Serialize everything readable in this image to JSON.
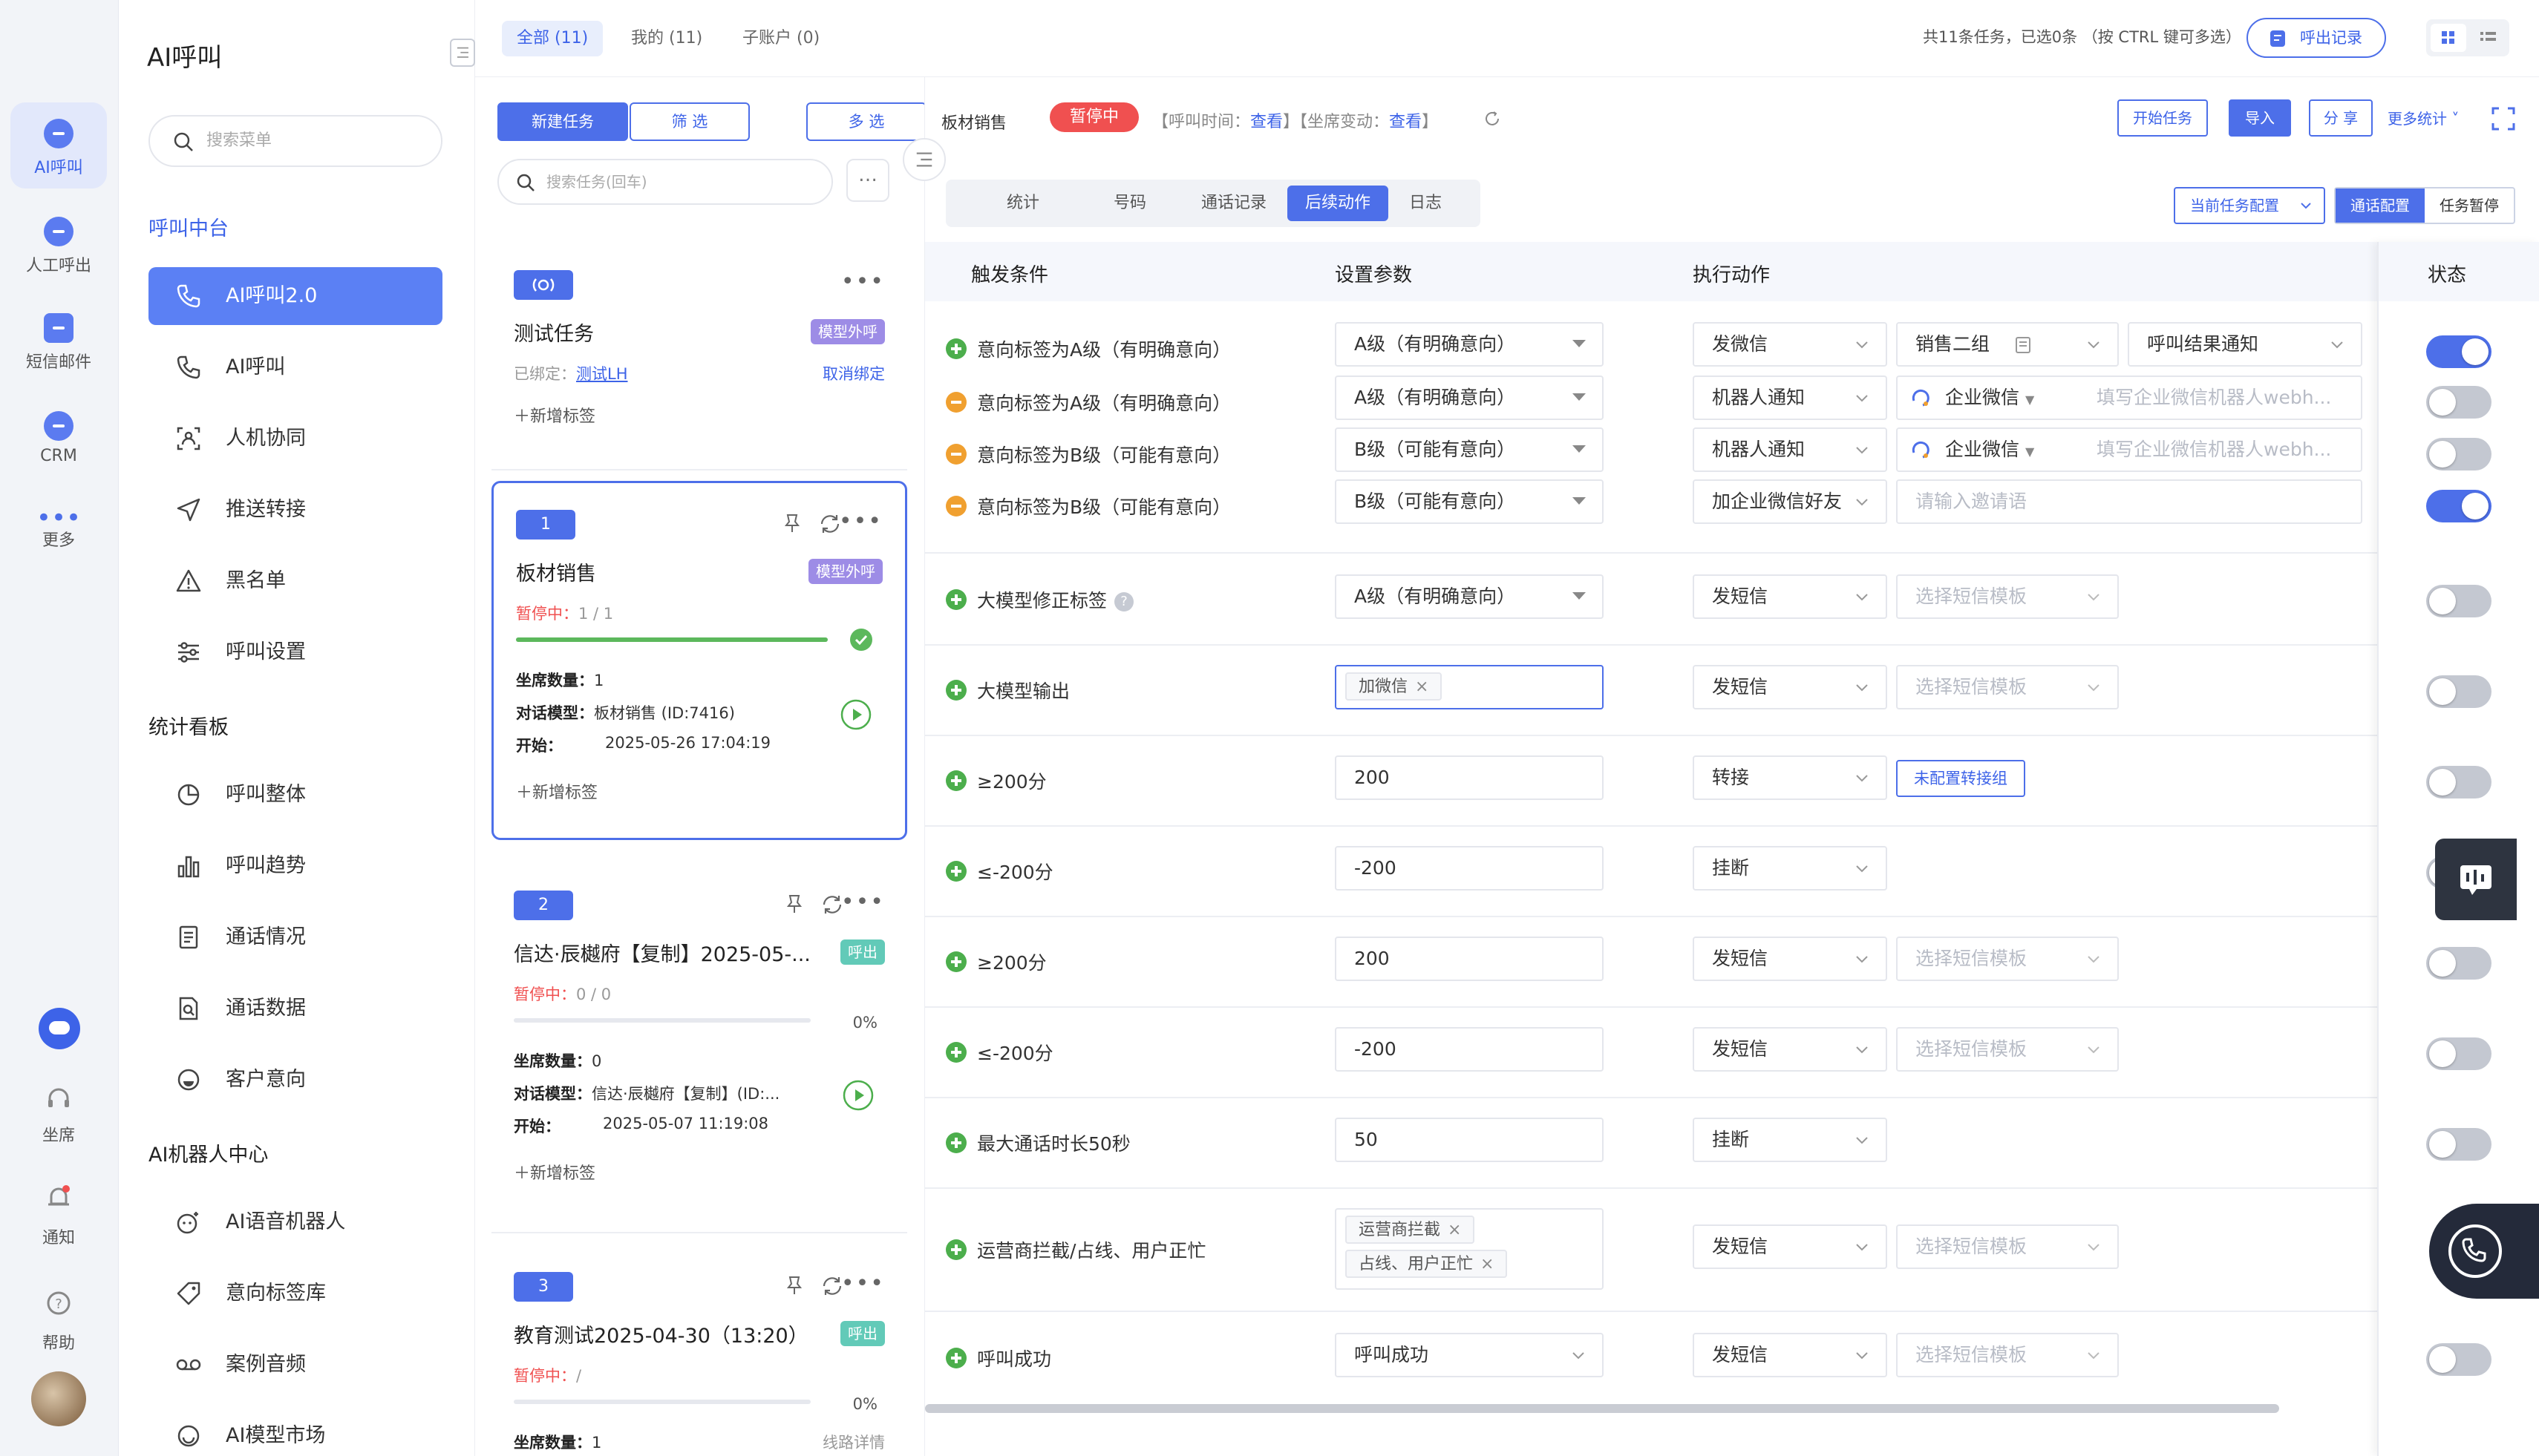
{
  "colors": {
    "primary": "#4d6fe9",
    "danger": "#f05050",
    "success": "#5cb85c",
    "warning": "#f0a030"
  },
  "rail": {
    "items": [
      {
        "label": "AI呼叫",
        "icon": "robot-icon",
        "active": true
      },
      {
        "label": "人工呼出",
        "icon": "headset-icon"
      },
      {
        "label": "短信邮件",
        "icon": "message-icon"
      },
      {
        "label": "CRM",
        "icon": "user-icon"
      },
      {
        "label": "更多",
        "icon": "more-icon"
      }
    ],
    "bottom": [
      {
        "label": "坐席",
        "icon": "headphone-icon"
      },
      {
        "label": "通知",
        "icon": "bell-icon"
      },
      {
        "label": "帮助",
        "icon": "help-icon"
      }
    ]
  },
  "menu": {
    "title": "AI呼叫",
    "search_placeholder": "搜索菜单",
    "sections": [
      {
        "label": "呼叫中台",
        "items": [
          {
            "label": "AI呼叫2.0",
            "icon": "phone-call-icon",
            "active": true
          },
          {
            "label": "AI呼叫",
            "icon": "phone-icon"
          },
          {
            "label": "人机协同",
            "icon": "collab-icon"
          },
          {
            "label": "推送转接",
            "icon": "send-icon"
          },
          {
            "label": "黑名单",
            "icon": "warning-icon"
          },
          {
            "label": "呼叫设置",
            "icon": "sliders-icon"
          }
        ]
      },
      {
        "label": "统计看板",
        "items": [
          {
            "label": "呼叫整体",
            "icon": "pie-chart-icon"
          },
          {
            "label": "呼叫趋势",
            "icon": "bar-chart-icon"
          },
          {
            "label": "通话情况",
            "icon": "document-icon"
          },
          {
            "label": "通话数据",
            "icon": "file-search-icon"
          },
          {
            "label": "客户意向",
            "icon": "smile-icon"
          }
        ]
      },
      {
        "label": "AI机器人中心",
        "items": [
          {
            "label": "AI语音机器人",
            "icon": "bot-icon"
          },
          {
            "label": "意向标签库",
            "icon": "tag-icon"
          },
          {
            "label": "案例音频",
            "icon": "voicemail-icon"
          },
          {
            "label": "AI模型市场",
            "icon": "market-icon"
          }
        ]
      }
    ]
  },
  "topbar": {
    "tabs": [
      {
        "label": "全部 (11)"
      },
      {
        "label": "我的 (11)"
      },
      {
        "label": "子账户 (0)"
      }
    ],
    "info": "共11条任务，已选0条 （按 CTRL 键可多选）",
    "callout_btn": "呼出记录"
  },
  "tasks": {
    "new_btn": "新建任务",
    "filter_btn": "筛 选",
    "multi_btn": "多 选",
    "search_placeholder": "搜索任务(回车)",
    "add_tag": "新增标签",
    "cards": [
      {
        "name": "测试任务",
        "tag": "模型外呼",
        "bound_label": "已绑定：",
        "bound_link": "测试LH",
        "unbind": "取消绑定"
      },
      {
        "num": "1",
        "name": "板材销售",
        "tag": "模型外呼",
        "status_label": "暂停中：",
        "status_val": "1 / 1",
        "progress": 1.0,
        "seats_label": "坐席数量：",
        "seats": "1",
        "model_label": "对话模型：",
        "model": "板材销售 (ID:7416)",
        "start_label": "开始：",
        "start": "2025-05-26 17:04:19"
      },
      {
        "num": "2",
        "name": "信达·辰樾府【复制】2025-05-...",
        "tag": "呼出",
        "status_label": "暂停中：",
        "status_val": "0 / 0",
        "progress": 0,
        "pct": "0%",
        "seats_label": "坐席数量：",
        "seats": "0",
        "model_label": "对话模型：",
        "model": "信达·辰樾府【复制】(ID:...",
        "start_label": "开始：",
        "start": "2025-05-07 11:19:08"
      },
      {
        "num": "3",
        "name": "教育测试2025-04-30（13:20）",
        "tag": "呼出",
        "status_label": "暂停中：",
        "status_val": "/",
        "progress": 0,
        "pct": "0%",
        "seats_label": "坐席数量：",
        "seats": "1",
        "partial": "线路详情"
      }
    ]
  },
  "detail": {
    "title": "板材销售",
    "badge": "暂停中",
    "meta_prefix": "【呼叫时间：",
    "meta_link1": "查看",
    "meta_mid": "】【坐席变动：",
    "meta_link2": "查看",
    "meta_suffix": "】",
    "buttons": {
      "start": "开始任务",
      "import": "导入",
      "share": "分 享",
      "more": "更多统计 ˅"
    },
    "subtabs": [
      "统计",
      "号码",
      "通话记录",
      "后续动作",
      "日志"
    ],
    "active_subtab": 3,
    "cfg_dropdown": "当前任务配置",
    "cfg_seg": [
      "通话配置",
      "任务暂停"
    ],
    "headers": {
      "trigger": "触发条件",
      "params": "设置参数",
      "action": "执行动作",
      "status": "状态"
    },
    "rows": [
      {
        "cond": "意向标签为A级（有明确意向）",
        "type": "plus",
        "param": "A级（有明确意向）",
        "action": "发微信",
        "extra1": "销售二组",
        "extra2": "呼叫结果通知",
        "on": true
      },
      {
        "cond": "意向标签为A级（有明确意向）",
        "type": "minus",
        "param": "A级（有明确意向）",
        "action": "机器人通知",
        "wx": "企业微信",
        "hook": "填写企业微信机器人webh...",
        "on": false
      },
      {
        "cond": "意向标签为B级（可能有意向）",
        "type": "minus",
        "param": "B级（可能有意向）",
        "action": "机器人通知",
        "wx": "企业微信",
        "hook": "填写企业微信机器人webh...",
        "on": false
      },
      {
        "cond": "意向标签为B级（可能有意向）",
        "type": "minus",
        "param": "B级（可能有意向）",
        "action": "加企业微信好友",
        "invite": "请输入邀请语",
        "on": true
      },
      {
        "cond": "大模型修正标签",
        "type": "plus",
        "help": "?",
        "param": "A级（有明确意向）",
        "action": "发短信",
        "tpl": "选择短信模板",
        "on": false
      },
      {
        "cond": "大模型输出",
        "type": "plus",
        "chip": "加微信",
        "action": "发短信",
        "tpl": "选择短信模板",
        "on": false
      },
      {
        "cond": "≥200分",
        "type": "plus",
        "value": "200",
        "action": "转接",
        "link": "未配置转接组",
        "on": false
      },
      {
        "cond": "≤-200分",
        "type": "plus",
        "value": "-200",
        "action": "挂断",
        "on": false
      },
      {
        "cond": "≥200分",
        "type": "plus",
        "value": "200",
        "action": "发短信",
        "tpl": "选择短信模板",
        "on": false
      },
      {
        "cond": "≤-200分",
        "type": "plus",
        "value": "-200",
        "action": "发短信",
        "tpl": "选择短信模板",
        "on": false
      },
      {
        "cond": "最大通话时长50秒",
        "type": "plus",
        "value": "50",
        "action": "挂断",
        "on": false
      },
      {
        "cond": "运营商拦截/占线、用户正忙",
        "type": "plus",
        "chips": [
          "运营商拦截",
          "占线、用户正忙"
        ],
        "action": "发短信",
        "tpl": "选择短信模板",
        "on": false
      },
      {
        "cond": "呼叫成功",
        "type": "plus",
        "param": "呼叫成功",
        "action": "发短信",
        "tpl": "选择短信模板",
        "on": false
      }
    ]
  }
}
